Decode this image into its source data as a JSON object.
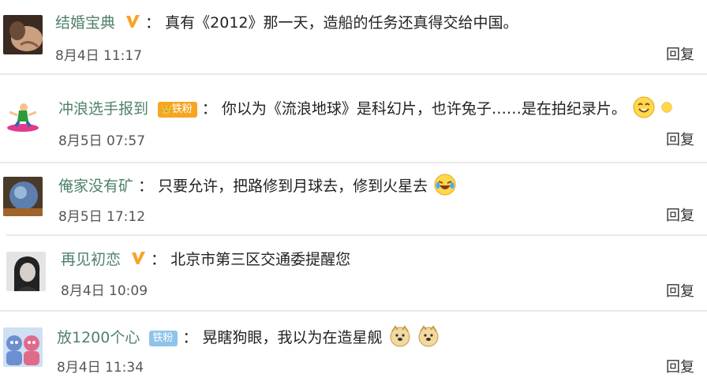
{
  "comments": [
    {
      "username": "结婚宝典",
      "colon": "：",
      "text": "真有《2012》那一天，造船的任务还真得交给中国。",
      "date": "8月4日 11:17",
      "reply_label": "回复"
    },
    {
      "username": "冲浪选手报到",
      "badge_label": "铁粉",
      "colon": "：",
      "text": "你以为《流浪地球》是科幻片，也许兔子……是在拍纪录片。",
      "date": "8月5日 07:57",
      "reply_label": "回复"
    },
    {
      "username": "俺家没有矿",
      "colon": "：",
      "text": "只要允许，把路修到月球去，修到火星去",
      "date": "8月5日 17:12",
      "reply_label": "回复"
    },
    {
      "username": "再见初恋",
      "colon": "：",
      "text": "北京市第三区交通委提醒您",
      "date": "8月4日 10:09",
      "reply_label": "回复"
    },
    {
      "username": "放1200个心",
      "badge_label": "铁粉",
      "colon": "：",
      "text": "晃瞎狗眼，我以为在造星舰",
      "date": "8月4日 11:34",
      "reply_label": "回复"
    }
  ],
  "colors": {
    "username": "#50816a",
    "vip_badge": "#f5a623",
    "fan_badge_orange": "#f5a623",
    "fan_badge_blue": "#8ec4ea",
    "separator": "#e9e9e9"
  },
  "icons": [
    "vip-v-icon",
    "fan-badge-icon",
    "smile-emoji-icon",
    "laugh-cry-emoji-icon",
    "doge-emoji-icon"
  ]
}
